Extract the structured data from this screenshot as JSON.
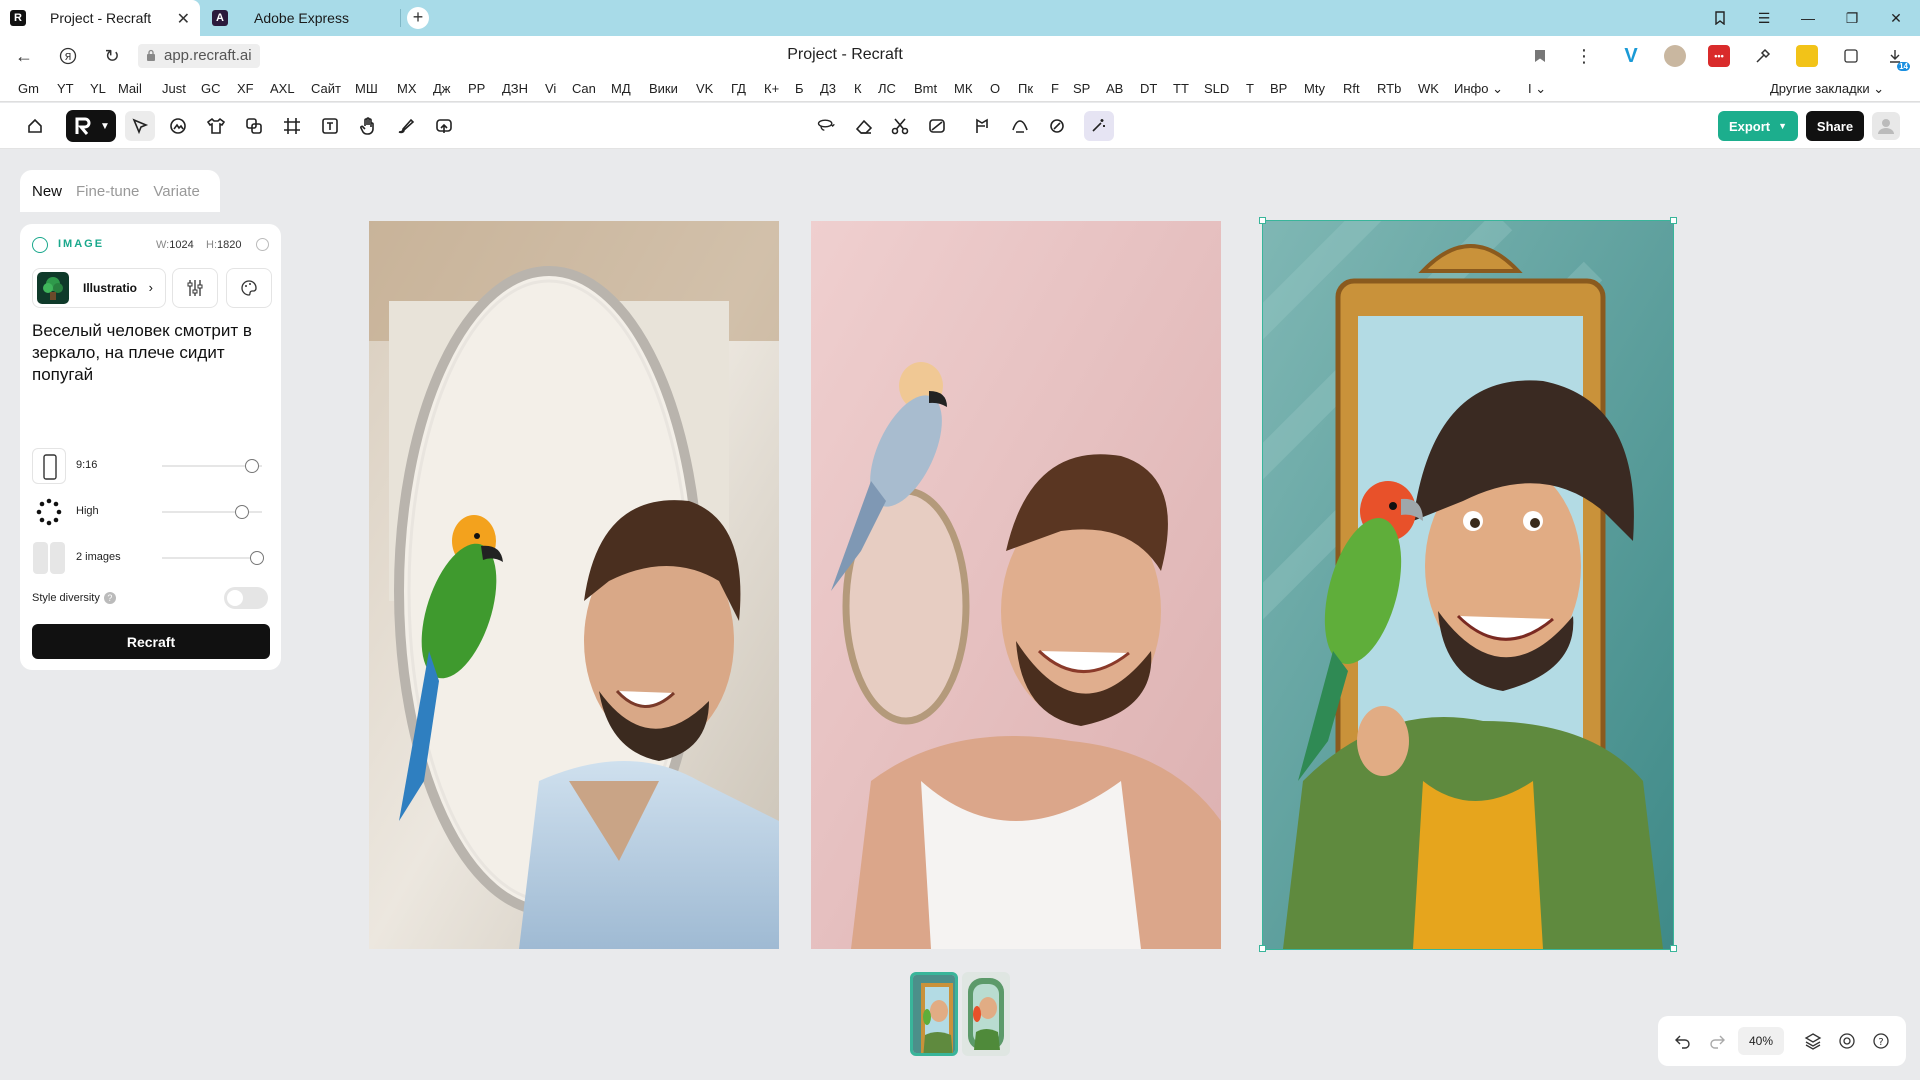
{
  "browser": {
    "tabs": [
      {
        "title": "Project - Recraft",
        "active": true,
        "favicon": "R"
      },
      {
        "title": "Adobe Express",
        "active": false,
        "favicon": "A"
      }
    ],
    "url": "app.recraft.ai",
    "page_title": "Project - Recraft",
    "extension_badge": "14",
    "bookmarks": [
      "Gm",
      "YT",
      "YL",
      "Mail",
      "Just",
      "GC",
      "XF",
      "AXL",
      "Сайт",
      "МШ",
      "МХ",
      "Дж",
      "РР",
      "ДЗН",
      "Vi",
      "Can",
      "МД",
      "Вики",
      "VK",
      "ГД",
      "К+",
      "Б",
      "Д3",
      "К",
      "ЛС",
      "Bmt",
      "МК",
      "О",
      "Пк",
      "F",
      "SP",
      "АВ",
      "DT",
      "TT",
      "SLD",
      "T",
      "ВР",
      "Mty",
      "Rft",
      "RTb",
      "WK",
      "Инфо",
      "I"
    ],
    "bookmarks_other": "Другие закладки"
  },
  "toolbar": {
    "export_label": "Export",
    "share_label": "Share"
  },
  "left_panel": {
    "tabs": [
      "New",
      "Fine-tune",
      "Variate"
    ],
    "active_tab": "New",
    "section_label": "IMAGE",
    "width_label": "W:",
    "width_value": "1024",
    "height_label": "H:",
    "height_value": "1820",
    "style_label": "Illustratio",
    "prompt": "Веселый человек смотрит в зеркало, на плече сидит попугай",
    "aspect_label": "9:16",
    "quality_label": "High",
    "count_label": "2 images",
    "diversity_label": "Style diversity",
    "diversity_on": false,
    "recraft_label": "Recraft",
    "sliders": {
      "aspect": 0.9,
      "quality": 0.8,
      "count": 0.95
    }
  },
  "canvas": {
    "images": [
      {
        "name": "photo-man-oval-mirror-parrot"
      },
      {
        "name": "photo-man-round-mirror-parrot-pink"
      },
      {
        "name": "cartoon-man-gold-mirror-parrot",
        "selected": true
      }
    ],
    "thumbnails": 2
  },
  "bottom_controls": {
    "zoom": "40%"
  },
  "colors": {
    "accent": "#1cae8d",
    "chrome": "#a8dbe8",
    "selection": "#39b59a"
  }
}
